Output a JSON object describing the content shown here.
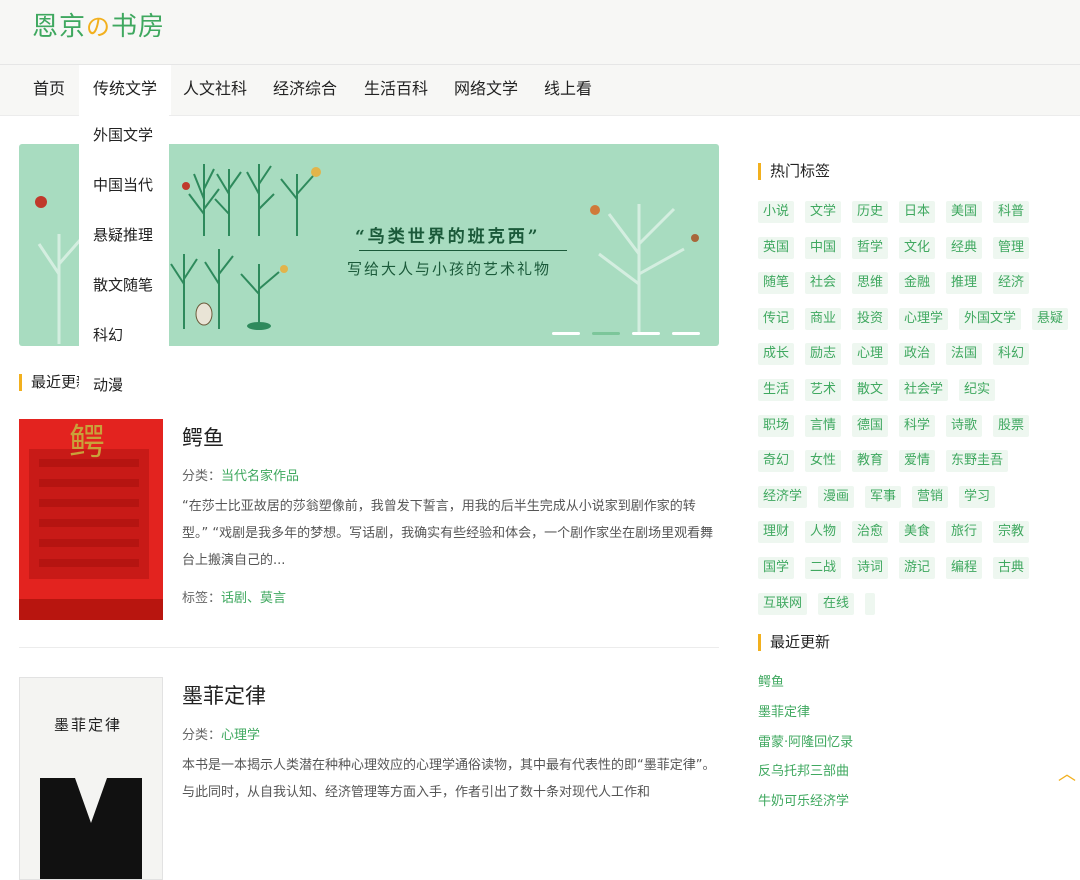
{
  "site": {
    "logo_a": "恩京",
    "logo_no": "の",
    "logo_b": "书房"
  },
  "nav": [
    "首页",
    "传统文学",
    "人文社科",
    "经济综合",
    "生活百科",
    "网络文学",
    "线上看"
  ],
  "dropdown": [
    "外国文学",
    "中国当代",
    "悬疑推理",
    "散文随笔",
    "科幻",
    "动漫"
  ],
  "banner": {
    "title": "“鸟类世界的班克西”",
    "subtitle": "写给大人与小孩的艺术礼物",
    "slides": 4,
    "active_slide": 2
  },
  "recent_heading_partial": "最近更新",
  "books": [
    {
      "title": "鳄鱼",
      "category_label": "分类：",
      "category": "当代名家作品",
      "desc": "“在莎士比亚故居的莎翁塑像前，我曾发下誓言，用我的后半生完成从小说家到剧作家的转型。” “戏剧是我多年的梦想。写话剧，我确实有些经验和体会，一个剧作家坐在剧场里观看舞台上搬演自己的...",
      "tags_label": "标签：",
      "tags": "话剧、莫言",
      "cover_text": "鳄"
    },
    {
      "title": "墨菲定律",
      "category_label": "分类：",
      "category": "心理学",
      "desc": "本书是一本揭示人类潜在种种心理效应的心理学通俗读物，其中最有代表性的即“墨菲定律”。 与此同时，从自我认知、经济管理等方面入手，作者引出了数十条对现代人工作和",
      "cover_text": "墨菲定律"
    }
  ],
  "sidebar": {
    "hot_tags_title": "热门标签",
    "tags": [
      "小说",
      "文学",
      "历史",
      "日本",
      "美国",
      "科普",
      "英国",
      "中国",
      "哲学",
      "文化",
      "经典",
      "管理",
      "随笔",
      "社会",
      "思维",
      "金融",
      "推理",
      "经济",
      "传记",
      "商业",
      "投资",
      "心理学",
      "外国文学",
      "悬疑",
      "成长",
      "励志",
      "心理",
      "政治",
      "法国",
      "科幻",
      "生活",
      "艺术",
      "散文",
      "社会学",
      "纪实",
      "职场",
      "言情",
      "德国",
      "科学",
      "诗歌",
      "股票",
      "奇幻",
      "女性",
      "教育",
      "爱情",
      "东野圭吾",
      "经济学",
      "漫画",
      "军事",
      "营销",
      "学习",
      "理财",
      "人物",
      "治愈",
      "美食",
      "旅行",
      "宗教",
      "国学",
      "二战",
      "诗词",
      "游记",
      "编程",
      "古典",
      "互联网",
      "在线"
    ],
    "recent_title": "最近更新",
    "recent": [
      "鳄鱼",
      "墨菲定律",
      "雷蒙·阿隆回忆录",
      "反乌托邦三部曲",
      "牛奶可乐经济学"
    ]
  },
  "colors": {
    "accent": "#3fa85f",
    "highlight": "#f2b01e",
    "banner": "#a8dcc0"
  },
  "icons": {
    "back_to_top": "chevron-up-icon"
  }
}
